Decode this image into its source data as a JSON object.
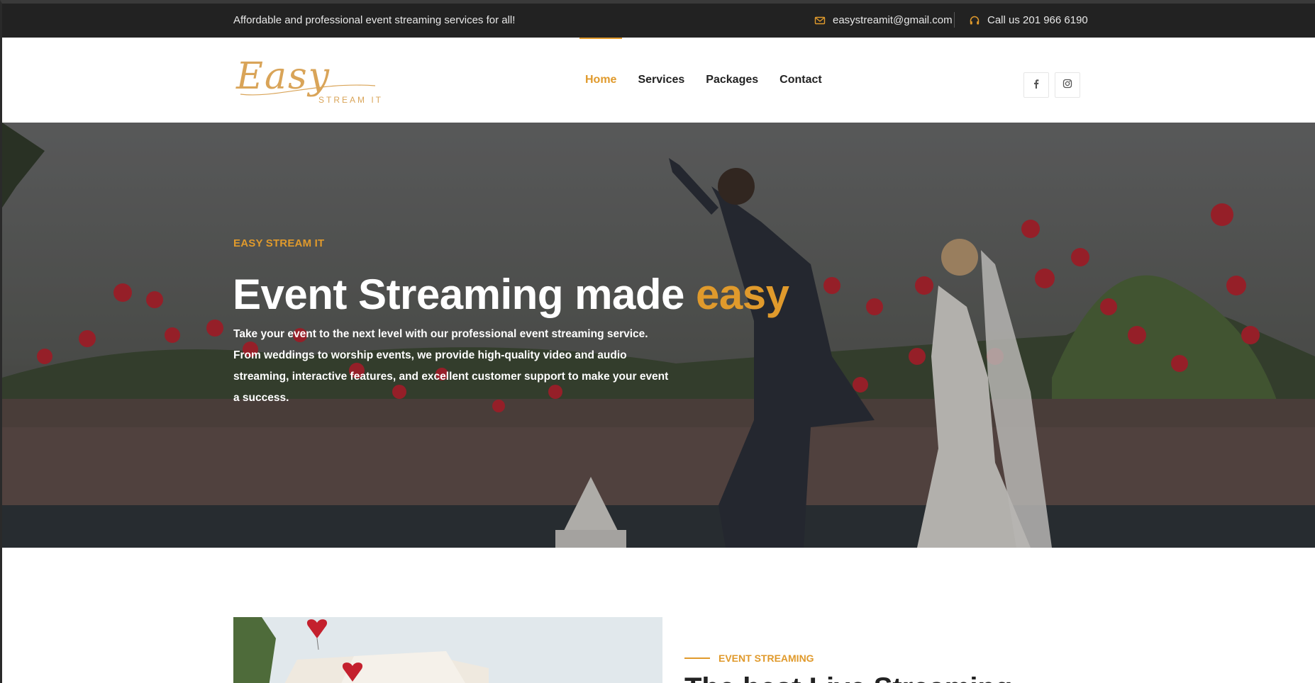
{
  "topbar": {
    "tagline": "Affordable and professional event streaming services for all!",
    "email": "easystreamit@gmail.com",
    "phone": "Call us 201 966 6190",
    "email_icon": "envelope-icon",
    "phone_icon": "headset-icon"
  },
  "logo": {
    "script_text": "Easy",
    "sub_text": "STREAM IT"
  },
  "nav": {
    "items": [
      {
        "label": "Home",
        "active": true
      },
      {
        "label": "Services",
        "active": false
      },
      {
        "label": "Packages",
        "active": false
      },
      {
        "label": "Contact",
        "active": false
      }
    ]
  },
  "social": {
    "facebook_icon": "facebook-icon",
    "instagram_icon": "instagram-icon"
  },
  "hero": {
    "kicker": "EASY STREAM IT",
    "title_main": "Event Streaming made ",
    "title_accent": "easy",
    "lead": "Take your event to the next level with our professional event streaming service. From weddings to worship events, we provide high-quality video and audio streaming, interactive features, and excellent customer support to make your event a success."
  },
  "section2": {
    "kicker": "EVENT STREAMING",
    "heading": "The best Live Streaming"
  },
  "colors": {
    "accent": "#e09a2c",
    "topbar_bg": "#222222",
    "text_dark": "#222222"
  }
}
